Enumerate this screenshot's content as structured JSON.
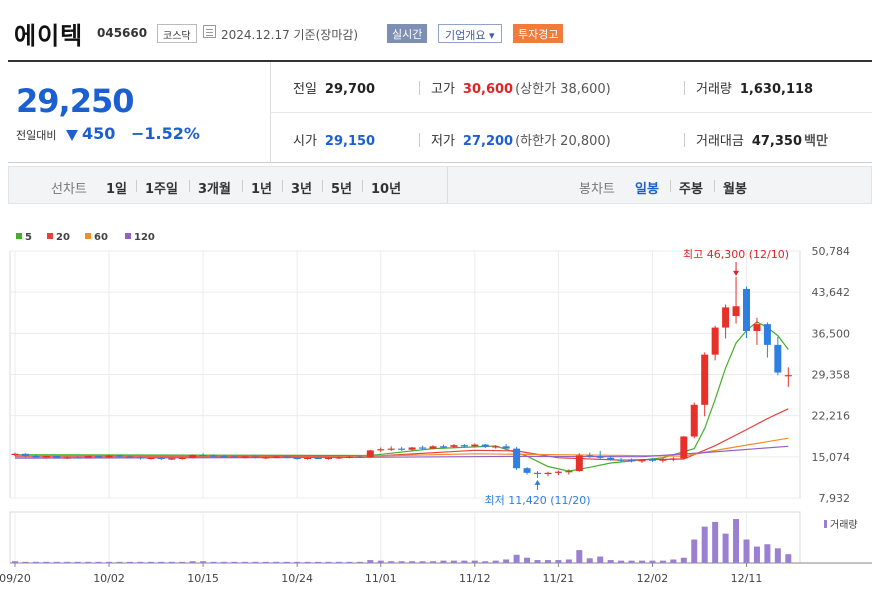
{
  "header": {
    "name": "에이텍",
    "code": "045660",
    "market": "코스닥",
    "date": "2024.12.17 기준(장마감)",
    "realtime_btn": "실시간",
    "info_btn": "기업개요 ▾",
    "warning_badge": "투자경고"
  },
  "summary": {
    "price": "29,250",
    "change_label": "전일대비",
    "change": "450",
    "change_pct": "−1.52%",
    "prev_close_label": "전일",
    "prev_close": "29,700",
    "high_label": "고가",
    "high": "30,600",
    "upper_limit": "(상한가 38,600)",
    "volume_label": "거래량",
    "volume": "1,630,118",
    "open_label": "시가",
    "open": "29,150",
    "low_label": "저가",
    "low": "27,200",
    "lower_limit": "(하한가 20,800)",
    "amount_label": "거래대금",
    "amount": "47,350",
    "amount_unit": "백만"
  },
  "tabs": {
    "line_label": "선차트",
    "periods": [
      "1일",
      "1주일",
      "3개월",
      "1년",
      "3년",
      "5년",
      "10년"
    ],
    "candle_label": "봉차트",
    "candle_types": [
      "일봉",
      "주봉",
      "월봉"
    ],
    "candle_selected": "일봉"
  },
  "chart_data": {
    "type": "candlestick",
    "legend": [
      {
        "name": "5",
        "color": "#43b02a"
      },
      {
        "name": "20",
        "color": "#e8413c"
      },
      {
        "name": "60",
        "color": "#f28c28"
      },
      {
        "name": "120",
        "color": "#9360c8"
      }
    ],
    "y_ticks": [
      "50,784",
      "43,642",
      "36,500",
      "29,358",
      "22,216",
      "15,074",
      "7,932"
    ],
    "y_tick_values": [
      50784,
      43642,
      36500,
      29358,
      22216,
      15074,
      7932
    ],
    "x_ticks": [
      "09/20",
      "10/02",
      "10/15",
      "10/24",
      "11/01",
      "11/12",
      "11/21",
      "12/02",
      "12/11"
    ],
    "x_tick_index": [
      0,
      9,
      18,
      27,
      35,
      44,
      52,
      61,
      70
    ],
    "high_annotation": "최고 46,300 (12/10)",
    "high_index": 69,
    "high_value": 46300,
    "low_annotation": "최저 11,420 (11/20)",
    "low_index": 50,
    "low_value": 11420,
    "volume_label": "거래량",
    "candles": [
      [
        15500,
        15800,
        15200,
        15600
      ],
      [
        15600,
        15700,
        15000,
        15200
      ],
      [
        15200,
        15400,
        14900,
        15100
      ],
      [
        15100,
        15300,
        14800,
        15200
      ],
      [
        15200,
        15300,
        14800,
        14900
      ],
      [
        14900,
        15100,
        14700,
        15000
      ],
      [
        15000,
        15200,
        14800,
        14900
      ],
      [
        14900,
        15300,
        14800,
        15200
      ],
      [
        15200,
        15300,
        14900,
        15000
      ],
      [
        15000,
        15400,
        14800,
        15300
      ],
      [
        15300,
        15400,
        15000,
        15100
      ],
      [
        15100,
        15300,
        14800,
        15000
      ],
      [
        15000,
        15100,
        14600,
        14800
      ],
      [
        14800,
        15000,
        14600,
        14900
      ],
      [
        14900,
        15000,
        14500,
        14700
      ],
      [
        14700,
        14900,
        14500,
        14800
      ],
      [
        14800,
        15000,
        14600,
        14900
      ],
      [
        14900,
        15500,
        14800,
        15400
      ],
      [
        15400,
        15700,
        15100,
        15300
      ],
      [
        15300,
        15500,
        15000,
        15200
      ],
      [
        15200,
        15400,
        15000,
        15100
      ],
      [
        15100,
        15300,
        14900,
        15000
      ],
      [
        15000,
        15200,
        14800,
        15100
      ],
      [
        15100,
        15300,
        14800,
        14900
      ],
      [
        14900,
        15100,
        14700,
        15000
      ],
      [
        15000,
        15200,
        14800,
        15100
      ],
      [
        15100,
        15200,
        14800,
        14900
      ],
      [
        14900,
        15000,
        14600,
        14800
      ],
      [
        14800,
        15000,
        14600,
        14900
      ],
      [
        14900,
        15100,
        14700,
        14800
      ],
      [
        14800,
        15000,
        14600,
        14900
      ],
      [
        14900,
        15100,
        14700,
        15000
      ],
      [
        15000,
        15200,
        14800,
        15100
      ],
      [
        15100,
        15300,
        14900,
        15000
      ],
      [
        15000,
        16300,
        14900,
        16200
      ],
      [
        16200,
        16700,
        15900,
        16400
      ],
      [
        16400,
        16900,
        16100,
        16500
      ],
      [
        16500,
        16800,
        16100,
        16300
      ],
      [
        16300,
        16800,
        16100,
        16700
      ],
      [
        16700,
        17000,
        16300,
        16500
      ],
      [
        16500,
        17100,
        16400,
        16900
      ],
      [
        16900,
        17200,
        16500,
        16800
      ],
      [
        16800,
        17300,
        16600,
        17100
      ],
      [
        17100,
        17300,
        16700,
        16900
      ],
      [
        16900,
        17400,
        16700,
        17200
      ],
      [
        17200,
        17300,
        16600,
        16800
      ],
      [
        16800,
        17100,
        16500,
        16900
      ],
      [
        16900,
        17300,
        16600,
        16500
      ],
      [
        16500,
        16800,
        12800,
        13100
      ],
      [
        13100,
        13300,
        12000,
        12300
      ],
      [
        12300,
        12600,
        11420,
        12100
      ],
      [
        12100,
        12500,
        11700,
        12300
      ],
      [
        12300,
        12700,
        11900,
        12500
      ],
      [
        12500,
        12900,
        12000,
        12600
      ],
      [
        12600,
        15700,
        12500,
        15300
      ],
      [
        15300,
        15800,
        14900,
        15200
      ],
      [
        15200,
        16100,
        14700,
        14900
      ],
      [
        14900,
        15200,
        14400,
        14600
      ],
      [
        14600,
        14900,
        14200,
        14500
      ],
      [
        14500,
        14800,
        14100,
        14300
      ],
      [
        14300,
        14700,
        14000,
        14600
      ],
      [
        14600,
        14900,
        14200,
        14500
      ],
      [
        14500,
        14900,
        14100,
        14600
      ],
      [
        14600,
        15000,
        14300,
        14800
      ],
      [
        14800,
        18700,
        14700,
        18600
      ],
      [
        18600,
        24500,
        18300,
        24100
      ],
      [
        24100,
        33200,
        22100,
        32800
      ],
      [
        32800,
        37800,
        31800,
        37500
      ],
      [
        37500,
        41500,
        35600,
        41000
      ],
      [
        39500,
        46300,
        38200,
        41200
      ],
      [
        44200,
        44600,
        35700,
        36900
      ],
      [
        36900,
        39200,
        34500,
        38100
      ],
      [
        38100,
        38400,
        32300,
        34500
      ],
      [
        34500,
        35900,
        29200,
        29700
      ],
      [
        29150,
        30600,
        27200,
        29250
      ]
    ],
    "ma": {
      "5": [
        [
          0,
          15450
        ],
        [
          34,
          15300
        ],
        [
          40,
          16500
        ],
        [
          46,
          16950
        ],
        [
          49,
          15200
        ],
        [
          51,
          13400
        ],
        [
          53,
          12600
        ],
        [
          55,
          13250
        ],
        [
          57,
          14000
        ],
        [
          62,
          14900
        ],
        [
          65,
          16500
        ],
        [
          66,
          20000
        ],
        [
          67,
          25000
        ],
        [
          68,
          30500
        ],
        [
          69,
          34800
        ],
        [
          70,
          37000
        ],
        [
          71,
          38500
        ],
        [
          72,
          37500
        ],
        [
          73,
          36100
        ],
        [
          74,
          33700
        ]
      ],
      "20": [
        [
          0,
          15200
        ],
        [
          34,
          15150
        ],
        [
          44,
          16200
        ],
        [
          48,
          16100
        ],
        [
          52,
          14900
        ],
        [
          58,
          14500
        ],
        [
          64,
          14700
        ],
        [
          67,
          17000
        ],
        [
          70,
          19800
        ],
        [
          72,
          21700
        ],
        [
          74,
          23400
        ]
      ],
      "60": [
        [
          0,
          14900
        ],
        [
          30,
          15050
        ],
        [
          44,
          15600
        ],
        [
          52,
          15450
        ],
        [
          64,
          15200
        ],
        [
          68,
          16500
        ],
        [
          74,
          18300
        ]
      ],
      "120": [
        [
          0,
          14850
        ],
        [
          30,
          14950
        ],
        [
          48,
          15150
        ],
        [
          60,
          15100
        ],
        [
          66,
          15800
        ],
        [
          74,
          16900
        ]
      ]
    },
    "volume": [
      3,
      2,
      2,
      2,
      2,
      2,
      2,
      2,
      2,
      2,
      2,
      2,
      2,
      2,
      2,
      2,
      2,
      3,
      3,
      2,
      2,
      2,
      2,
      2,
      2,
      2,
      2,
      2,
      2,
      2,
      2,
      2,
      2,
      2,
      5,
      4,
      3,
      3,
      3,
      3,
      3,
      4,
      4,
      4,
      4,
      3,
      4,
      6,
      14,
      9,
      5,
      5,
      5,
      6,
      22,
      8,
      11,
      5,
      4,
      4,
      4,
      4,
      4,
      6,
      9,
      40,
      62,
      70,
      50,
      75,
      40,
      28,
      32,
      25,
      15
    ]
  }
}
